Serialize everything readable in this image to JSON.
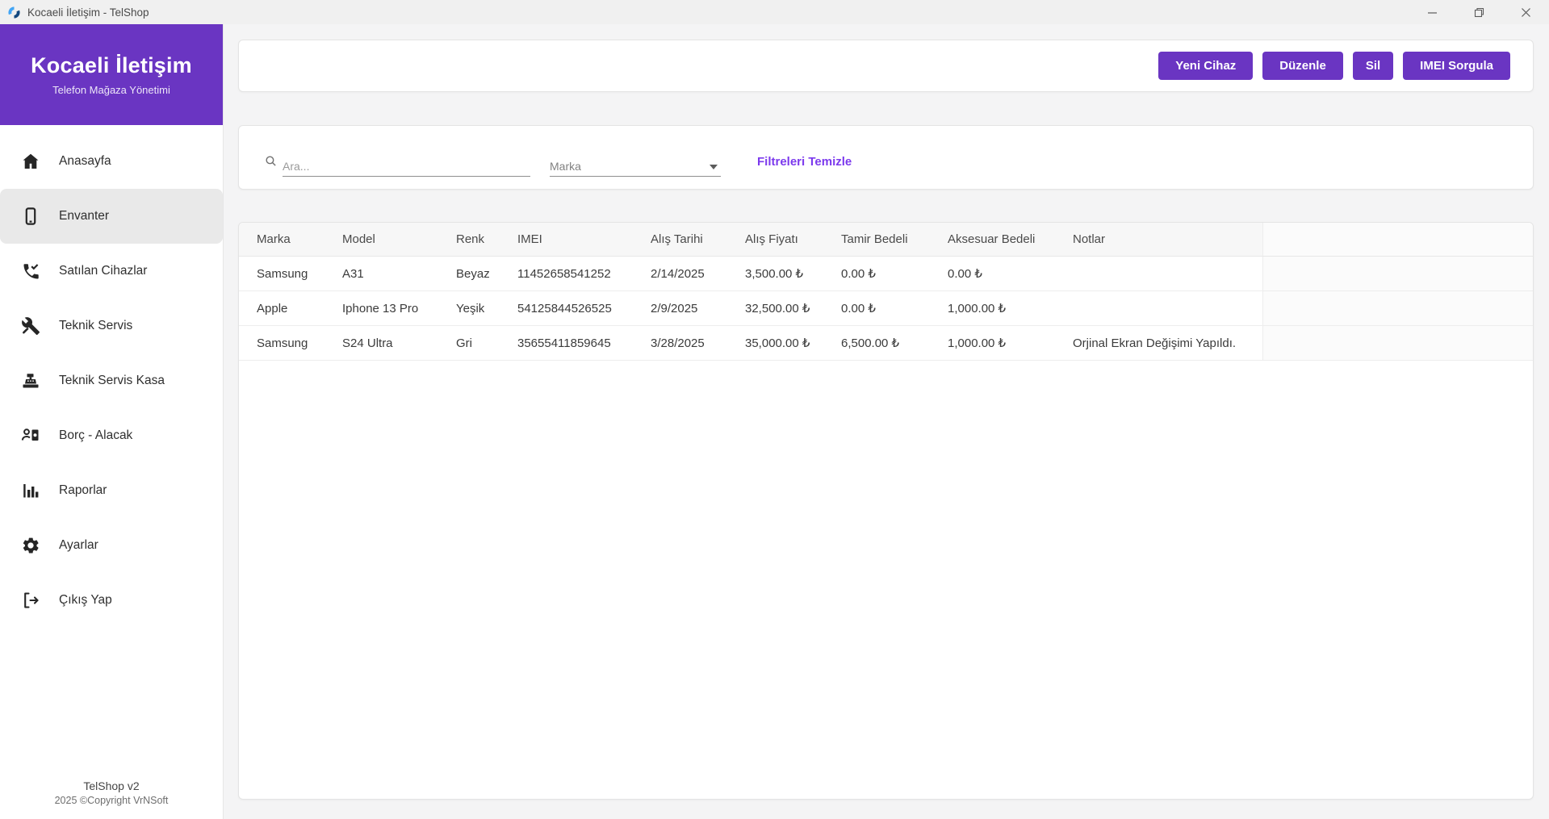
{
  "colors": {
    "accent": "#6A35C2",
    "link": "#7C3AED"
  },
  "window": {
    "title": "Kocaeli İletişim - TelShop",
    "app_icon": "telshop-logo-icon",
    "controls": [
      "minimize-icon",
      "restore-icon",
      "close-icon"
    ]
  },
  "sidebar": {
    "brand": {
      "title": "Kocaeli İletişim",
      "subtitle": "Telefon Mağaza Yönetimi"
    },
    "items": [
      {
        "label": "Anasayfa",
        "icon": "home-icon",
        "active": false
      },
      {
        "label": "Envanter",
        "icon": "smartphone-icon",
        "active": true
      },
      {
        "label": "Satılan Cihazlar",
        "icon": "phone-check-icon",
        "active": false
      },
      {
        "label": "Teknik Servis",
        "icon": "tools-icon",
        "active": false
      },
      {
        "label": "Teknik Servis Kasa",
        "icon": "cash-register-icon",
        "active": false
      },
      {
        "label": "Borç - Alacak",
        "icon": "person-money-icon",
        "active": false
      },
      {
        "label": "Raporlar",
        "icon": "bar-chart-icon",
        "active": false
      },
      {
        "label": "Ayarlar",
        "icon": "gear-icon",
        "active": false
      },
      {
        "label": "Çıkış Yap",
        "icon": "logout-icon",
        "active": false
      }
    ],
    "footer": {
      "line1": "TelShop v2",
      "line2": "2025 ©Copyright VrNSoft"
    }
  },
  "toolbar": {
    "buttons": [
      "Yeni Cihaz",
      "Düzenle",
      "Sil",
      "IMEI Sorgula"
    ]
  },
  "filters": {
    "search_placeholder": "Ara...",
    "search_icon": "search-icon",
    "brand_placeholder": "Marka",
    "caret_icon": "caret-down-icon",
    "clear_label": "Filtreleri Temizle"
  },
  "table": {
    "columns": [
      "Marka",
      "Model",
      "Renk",
      "IMEI",
      "Alış Tarihi",
      "Alış Fiyatı",
      "Tamir Bedeli",
      "Aksesuar Bedeli",
      "Notlar"
    ],
    "rows": [
      [
        "Samsung",
        "A31",
        "Beyaz",
        "11452658541252",
        "2/14/2025",
        "3,500.00 ₺",
        "0.00 ₺",
        "0.00 ₺",
        ""
      ],
      [
        "Apple",
        "Iphone 13 Pro",
        "Yeşik",
        "54125844526525",
        "2/9/2025",
        "32,500.00 ₺",
        "0.00 ₺",
        "1,000.00 ₺",
        ""
      ],
      [
        "Samsung",
        "S24 Ultra",
        "Gri",
        "35655411859645",
        "3/28/2025",
        "35,000.00 ₺",
        "6,500.00 ₺",
        "1,000.00 ₺",
        "Orjinal Ekran Değişimi Yapıldı."
      ]
    ]
  }
}
